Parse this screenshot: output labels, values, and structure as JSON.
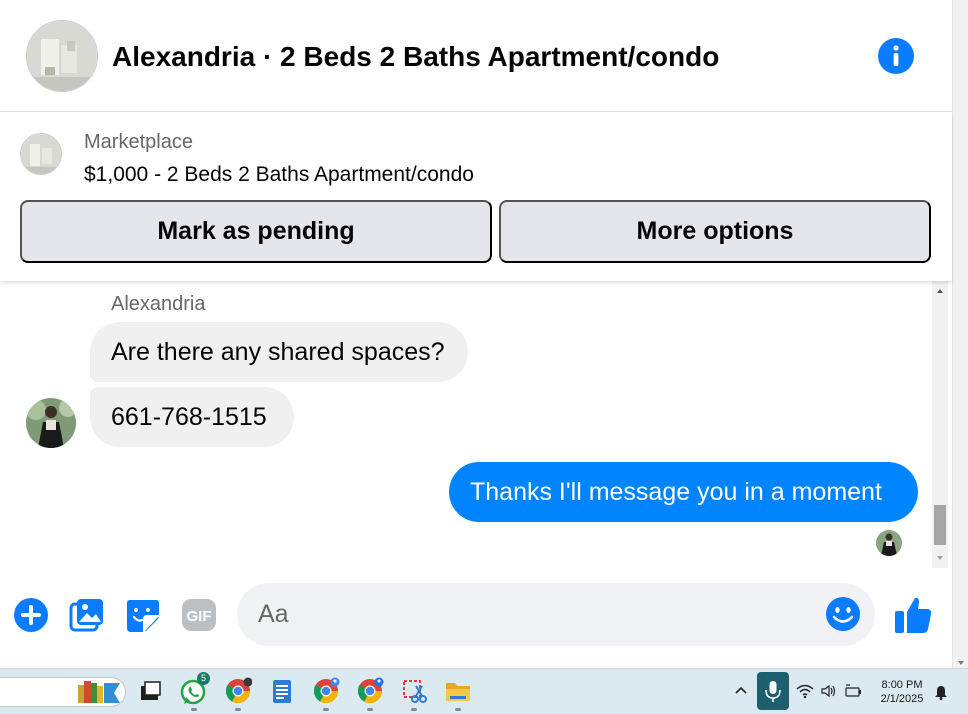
{
  "header": {
    "title": "Alexandria · 2 Beds 2 Baths Apartment/condo",
    "info_icon": "info-circle-icon"
  },
  "listing": {
    "source": "Marketplace",
    "title": "$1,000 - 2 Beds 2 Baths Apartment/condo",
    "actions": {
      "pending_label": "Mark as pending",
      "more_label": "More options"
    }
  },
  "thread": {
    "sender_name": "Alexandria",
    "messages": [
      {
        "direction": "incoming",
        "text": "Are there any shared spaces?"
      },
      {
        "direction": "incoming",
        "text": "661-768-1515"
      },
      {
        "direction": "outgoing",
        "text": "Thanks I'll message you in a moment"
      }
    ]
  },
  "composer": {
    "placeholder": "Aa",
    "icons": [
      "plus-circle-icon",
      "photo-icon",
      "sticker-icon",
      "gif-icon",
      "emoji-icon",
      "thumbs-up-icon"
    ],
    "gif_label": "GIF"
  },
  "taskbar": {
    "apps": [
      "file-explorer-stack-icon",
      "task-view-icon",
      "whatsapp-icon",
      "chrome-icon",
      "notepad-icon",
      "chrome-profile-icon",
      "chrome-profile-2-icon",
      "snipping-tool-icon",
      "folder-icon"
    ],
    "whatsapp_badge": "5",
    "time": "8:00 PM",
    "date": "2/1/2025"
  },
  "colors": {
    "brand_blue": "#0084ff",
    "icon_blue": "#0a7cff",
    "bubble_gray": "#f0f0f0",
    "button_gray": "#e4e6eb"
  }
}
